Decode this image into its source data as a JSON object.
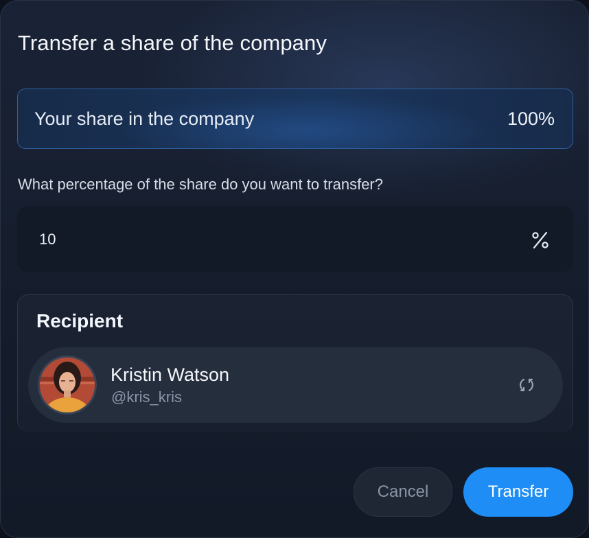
{
  "dialog": {
    "title": "Transfer a share of the company"
  },
  "share": {
    "label": "Your share in the company",
    "value": "100%"
  },
  "transfer_percent": {
    "question": "What percentage of the share do you want to transfer?",
    "value": "10",
    "unit_icon": "percent-icon"
  },
  "recipient": {
    "section_title": "Recipient",
    "name": "Kristin Watson",
    "handle": "@kris_kris",
    "avatar_icon": "avatar-photo",
    "swap_icon": "swap-icon"
  },
  "actions": {
    "cancel_label": "Cancel",
    "transfer_label": "Transfer"
  },
  "colors": {
    "accent": "#1e8df5",
    "background": "#161e2e",
    "share_border": "#2e5f9e"
  }
}
